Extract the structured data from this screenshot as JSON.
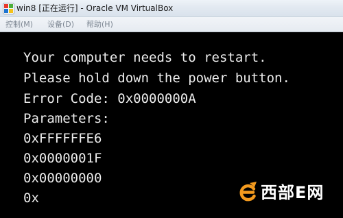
{
  "window": {
    "title": "win8 [正在运行] - Oracle VM VirtualBox",
    "app_icon": "virtualbox-icon"
  },
  "menubar": {
    "items": [
      {
        "label": "控制(M)"
      },
      {
        "label": "设备(D)"
      },
      {
        "label": "帮助(H)"
      }
    ]
  },
  "screen": {
    "lines": [
      "Your computer needs to restart.",
      "Please hold down the power button.",
      "Error Code: 0x0000000A",
      "Parameters:",
      "0xFFFFFFE6",
      "0x0000001F",
      "0x00000000",
      "0x"
    ]
  },
  "watermark": {
    "text": "西部E网",
    "logo_icon": "cnw-e-logo-icon",
    "color": "#f39a1e"
  }
}
